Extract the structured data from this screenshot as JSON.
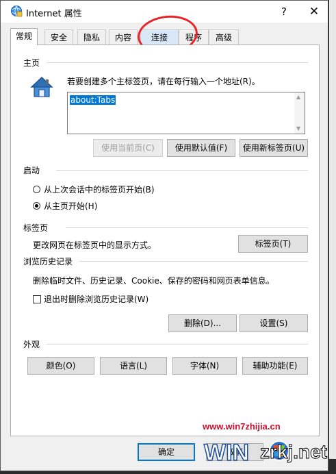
{
  "window": {
    "title": "Internet 属性",
    "help_label": "?",
    "close_label": "✕"
  },
  "tabs": [
    {
      "label": "常规",
      "active": true
    },
    {
      "label": "安全"
    },
    {
      "label": "隐私"
    },
    {
      "label": "内容"
    },
    {
      "label": "连接",
      "highlighted": true
    },
    {
      "label": "程序"
    },
    {
      "label": "高级"
    }
  ],
  "homepage": {
    "section_title": "主页",
    "instruction": "若要创建多个主标签页，请在每行输入一个地址(R)。",
    "value": "about:Tabs",
    "use_current_label": "使用当前页(C)",
    "use_default_label": "使用默认值(F)",
    "use_new_tab_label": "使用新标签页(U)"
  },
  "startup": {
    "section_title": "启动",
    "option_last_session": "从上次会话中的标签页开始(B)",
    "option_home_page": "从主页开始(H)",
    "selected": "option_home_page"
  },
  "tabs_section": {
    "section_title": "标签页",
    "description": "更改网页在标签页中的显示方式。",
    "button_label": "标签页(T)"
  },
  "history": {
    "section_title": "浏览历史记录",
    "description": "删除临时文件、历史记录、Cookie、保存的密码和网页表单信息。",
    "delete_on_exit_label": "退出时删除浏览历史记录(W)",
    "delete_on_exit_checked": false,
    "delete_label": "删除(D)...",
    "settings_label": "设置(S)"
  },
  "appearance": {
    "section_title": "外观",
    "colors_label": "颜色(O)",
    "languages_label": "语言(L)",
    "fonts_label": "字体(N)",
    "accessibility_label": "辅助功能(E)"
  },
  "footer": {
    "ok_label": "确定",
    "cancel_label": "取消"
  },
  "watermark": {
    "url": "www.win7zhijia.cn",
    "site": "zrkj.net"
  },
  "colors": {
    "accent": "#0078d7",
    "annotation_red": "#e8242a",
    "watermark_red": "#c8102e"
  }
}
